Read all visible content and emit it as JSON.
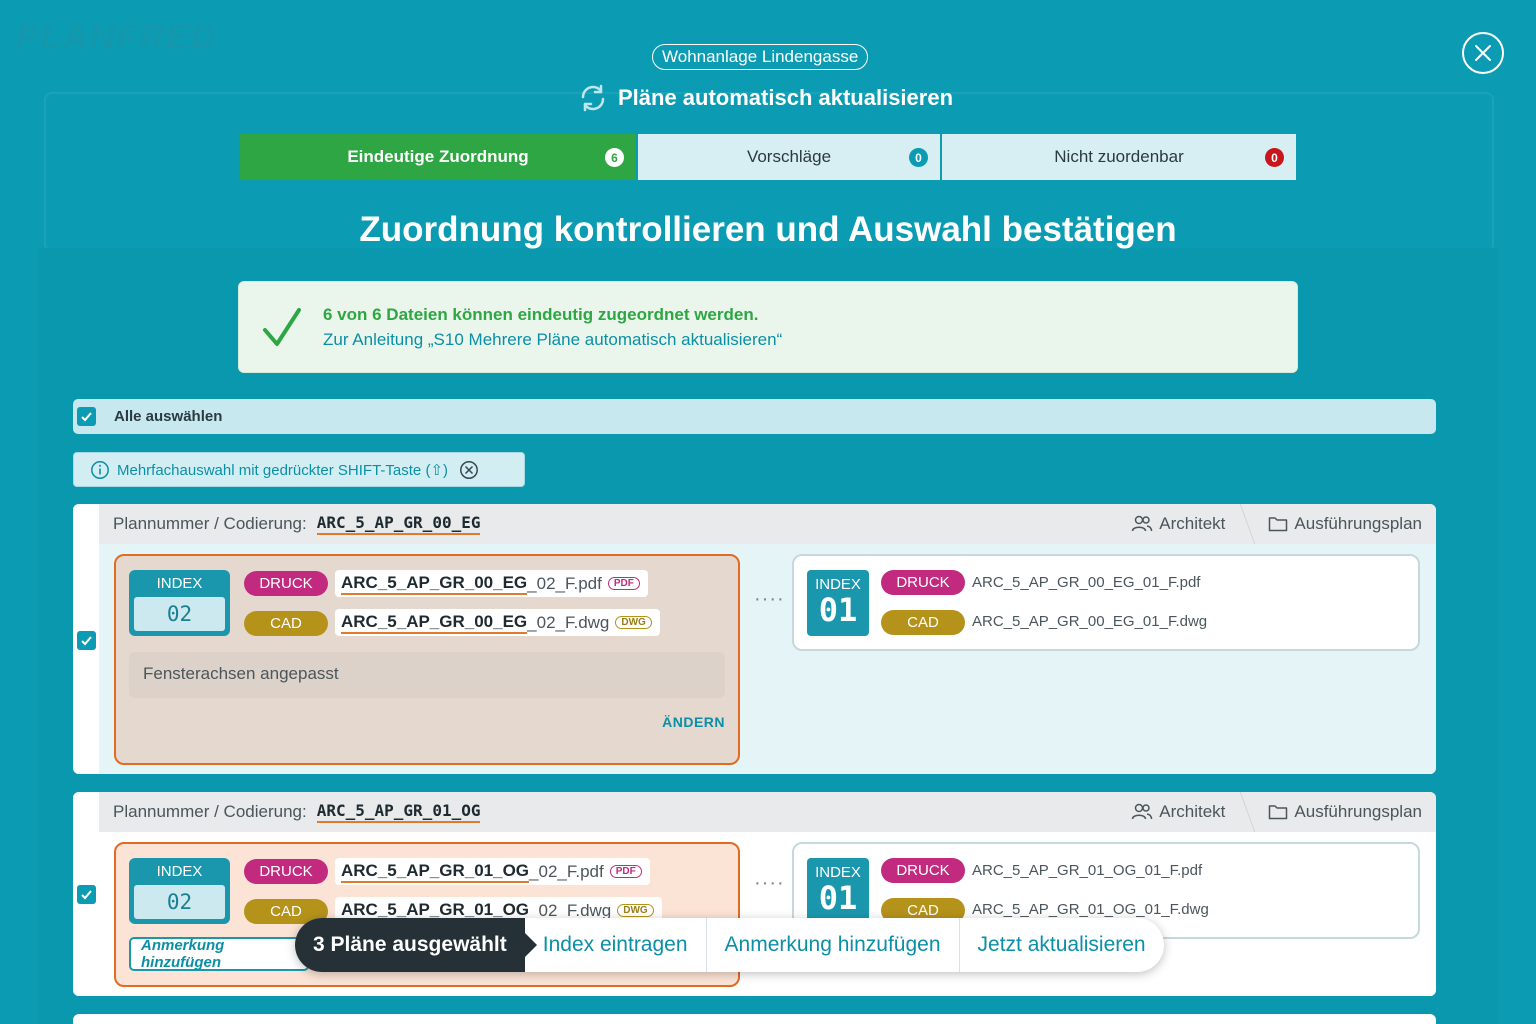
{
  "project_name": "Wohnanlage Lindengasse",
  "modal_title": "Pläne automatisch aktualisieren",
  "tabs": [
    {
      "label": "Eindeutige Zuordnung",
      "count": "6"
    },
    {
      "label": "Vorschläge",
      "count": "0"
    },
    {
      "label": "Nicht zuordenbar",
      "count": "0"
    }
  ],
  "heading": "Zuordnung kontrollieren und Auswahl bestätigen",
  "info": {
    "line1": "6 von 6 Dateien können eindeutig zugeordnet werden.",
    "line2": "Zur Anleitung „S10 Mehrere Pläne automatisch aktualisieren“"
  },
  "select_all_label": "Alle auswählen",
  "hint_text": "Mehrfachauswahl mit gedrückter SHIFT-Taste (⇧)",
  "rows": [
    {
      "head_label": "Plannummer / Codierung:",
      "code": "ARC_5_AP_GR_00_EG",
      "role": "Architekt",
      "plan_type": "Ausführungsplan",
      "new_index_label": "INDEX",
      "new_index": "02",
      "new_druck_label": "DRUCK",
      "new_druck_bold": "ARC_5_AP_GR_00_EG",
      "new_druck_rest": "_02_F.pdf",
      "new_druck_type": "PDF",
      "new_cad_label": "CAD",
      "new_cad_bold": "ARC_5_AP_GR_00_EG",
      "new_cad_rest": "_02_F.dwg",
      "new_cad_type": "DWG",
      "note": "Fensterachsen angepasst",
      "change_label": "ÄNDERN",
      "old_index_label": "INDEX",
      "old_index": "01",
      "old_druck_label": "DRUCK",
      "old_druck_file": "ARC_5_AP_GR_00_EG_01_F.pdf",
      "old_cad_label": "CAD",
      "old_cad_file": "ARC_5_AP_GR_00_EG_01_F.dwg"
    },
    {
      "head_label": "Plannummer / Codierung:",
      "code": "ARC_5_AP_GR_01_OG",
      "role": "Architekt",
      "plan_type": "Ausführungsplan",
      "new_index_label": "INDEX",
      "new_index": "02",
      "new_druck_label": "DRUCK",
      "new_druck_bold": "ARC_5_AP_GR_01_OG",
      "new_druck_rest": "_02_F.pdf",
      "new_druck_type": "PDF",
      "new_cad_label": "CAD",
      "new_cad_bold": "ARC_5_AP_GR_01_OG",
      "new_cad_rest": "_02_F.dwg",
      "new_cad_type": "DWG",
      "add_note_label": "Anmerkung hinzufügen",
      "old_index_label": "INDEX",
      "old_index": "01",
      "old_druck_label": "DRUCK",
      "old_druck_file": "ARC_5_AP_GR_01_OG_01_F.pdf",
      "old_cad_label": "CAD",
      "old_cad_file": "ARC_5_AP_GR_01_OG_01_F.dwg"
    }
  ],
  "action_bar": {
    "selected": "3 Pläne ausgewählt",
    "index": "Index eintragen",
    "note": "Anmerkung hinzufügen",
    "update": "Jetzt aktualisieren"
  },
  "colors": {
    "background": "#0b9cb3",
    "success": "#2ea643",
    "accent_orange": "#e06c24",
    "druck": "#c12a7e",
    "cad": "#b5921a",
    "danger": "#c9161d"
  },
  "icons": [
    "close-icon",
    "sync-icon",
    "check-icon",
    "info-icon",
    "clear-icon",
    "users-icon",
    "folder-icon",
    "checkbox-icon"
  ]
}
